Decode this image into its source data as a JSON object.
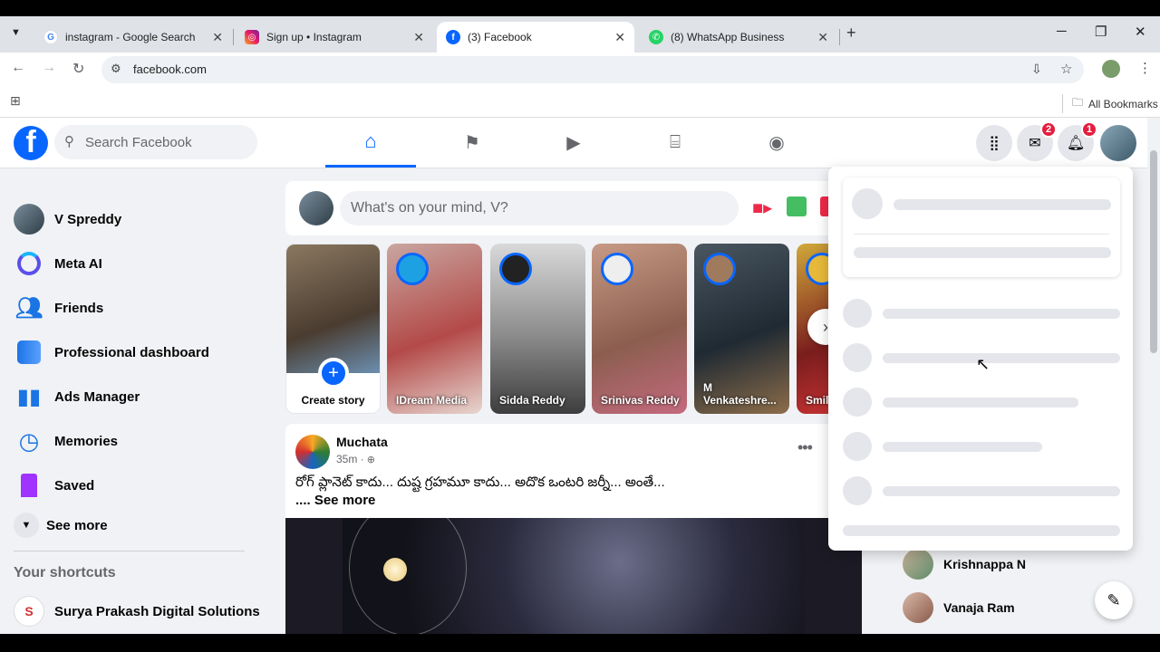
{
  "browser": {
    "tabs": [
      {
        "title": "instagram - Google Search",
        "favicon": "google-icon",
        "active": false
      },
      {
        "title": "Sign up • Instagram",
        "favicon": "instagram-icon",
        "active": false
      },
      {
        "title": "(3) Facebook",
        "favicon": "facebook-icon",
        "active": true
      },
      {
        "title": "(8) WhatsApp Business",
        "favicon": "whatsapp-icon",
        "active": false
      }
    ],
    "url": "facebook.com",
    "bookmarks_label": "All Bookmarks"
  },
  "facebook": {
    "search_placeholder": "Search Facebook",
    "messenger_badge": "2",
    "notifications_badge": "1",
    "composer_placeholder": "What's on your mind, V?",
    "left_nav": [
      {
        "label": "V Spreddy",
        "icon": "avatar"
      },
      {
        "label": "Meta AI",
        "icon": "meta-ai-icon"
      },
      {
        "label": "Friends",
        "icon": "friends-icon"
      },
      {
        "label": "Professional dashboard",
        "icon": "dashboard-icon"
      },
      {
        "label": "Ads Manager",
        "icon": "ads-manager-icon"
      },
      {
        "label": "Memories",
        "icon": "memories-icon"
      },
      {
        "label": "Saved",
        "icon": "saved-icon"
      }
    ],
    "see_more": "See more",
    "shortcuts_title": "Your shortcuts",
    "shortcuts": [
      {
        "label": "Surya Prakash Digital Solutions"
      }
    ],
    "stories": {
      "create_label": "Create story",
      "items": [
        {
          "name": "IDream Media"
        },
        {
          "name": "Sidda Reddy"
        },
        {
          "name": "Srinivas Reddy"
        },
        {
          "name": "M Venkateshre..."
        },
        {
          "name": "Smil"
        }
      ]
    },
    "post": {
      "author": "Muchata",
      "time": "35m ·",
      "text": "రోగ్ ప్లానెట్ కాదు... దుష్ట గ్రహమూ కాదు... అదొక ఒంటరి జర్నీ... అంతే...",
      "see_more": ".... See more"
    },
    "contacts": [
      {
        "name": "Krishnappa N"
      },
      {
        "name": "Vanaja Ram"
      }
    ]
  }
}
